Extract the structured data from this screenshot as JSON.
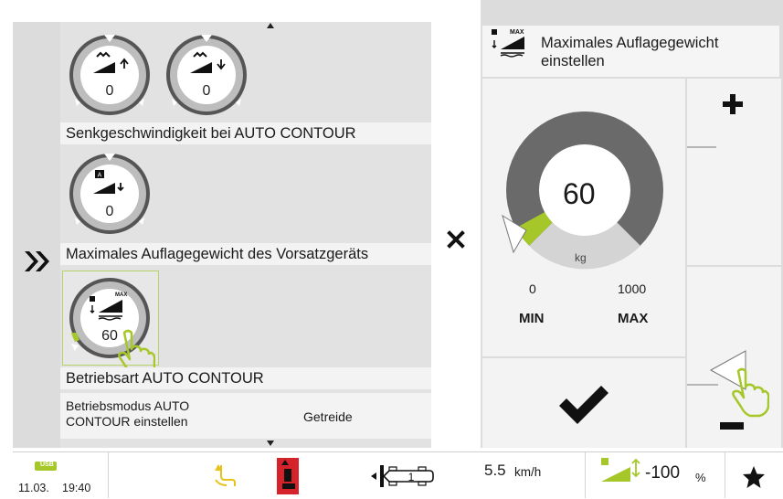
{
  "navigation": {
    "expand_icon": "double-chevron-right-icon",
    "close_icon": "close-x-icon",
    "scroll_up_icon": "triangle-up-icon",
    "scroll_down_icon": "triangle-down-icon"
  },
  "settings_list": {
    "dials_row1": [
      {
        "value": "0",
        "icon": "lowering-speed-up-icon"
      },
      {
        "value": "0",
        "icon": "lowering-speed-down-icon"
      }
    ],
    "row1_label": "Senkgeschwindigkeit bei AUTO CONTOUR",
    "dial_row2": {
      "value": "0",
      "icon": "auto-contour-icon"
    },
    "row2_label": "Maximales Auflagegewicht des Vorsatzgeräts",
    "dial_row3": {
      "value": "60",
      "icon": "max-weight-icon",
      "badge": "MAX"
    },
    "row3_label": "Betriebsart AUTO CONTOUR",
    "mode_row": {
      "label": "Betriebsmodus AUTO CONTOUR einstellen",
      "value": "Getreide"
    }
  },
  "popup": {
    "title": "Maximales Auflagegewicht einstellen",
    "header_badge": "MAX",
    "gauge": {
      "value": "60",
      "unit": "kg",
      "min_value": "0",
      "max_value": "1000",
      "min_label": "MIN",
      "max_label": "MAX",
      "level_fraction": 0.06
    },
    "plus_icon": "plus-icon",
    "minus_icon": "minus-icon",
    "confirm_icon": "checkmark-icon"
  },
  "status_bar": {
    "usb_label": "USB",
    "date": "11.03.",
    "time": "19:40",
    "speed_value": "5.5",
    "speed_unit": "km/h",
    "gear_value": "1",
    "header_percent": "-100",
    "percent_unit": "%",
    "favorite_icon": "star-icon",
    "colors": {
      "accent_green": "#a6c72a",
      "alert_red": "#d4232a",
      "warning_yellow": "#e8c21a"
    }
  }
}
